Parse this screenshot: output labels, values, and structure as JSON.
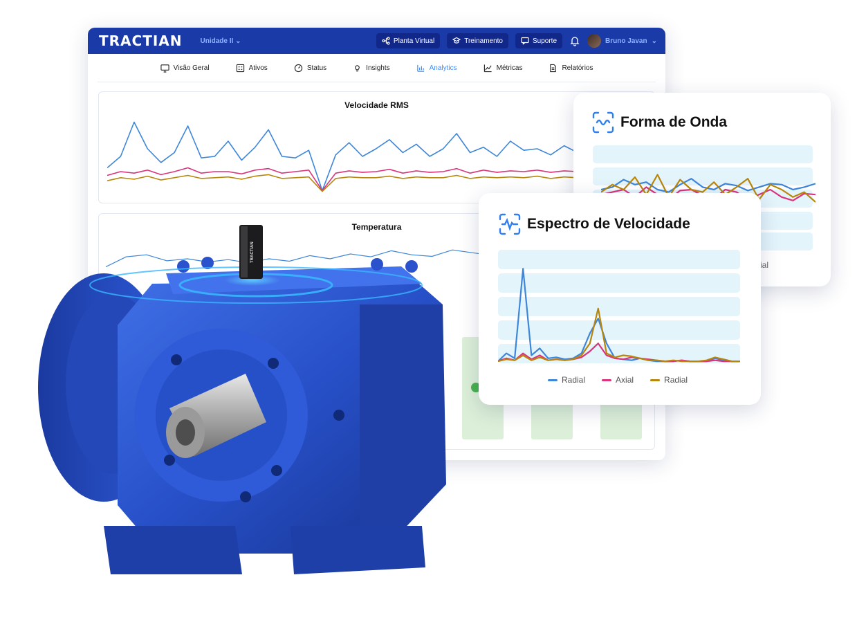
{
  "header": {
    "logo": "TRACTIAN",
    "unit": "Unidade II",
    "buttons": [
      {
        "label": "Planta Virtual",
        "icon": "network-icon"
      },
      {
        "label": "Treinamento",
        "icon": "training-icon"
      },
      {
        "label": "Suporte",
        "icon": "chat-icon"
      }
    ],
    "user": "Bruno Javan"
  },
  "tabs": [
    {
      "label": "Visão Geral",
      "icon": "monitor-icon"
    },
    {
      "label": "Ativos",
      "icon": "assets-icon"
    },
    {
      "label": "Status",
      "icon": "gauge-icon"
    },
    {
      "label": "Insights",
      "icon": "lightbulb-icon"
    },
    {
      "label": "Analytics",
      "icon": "bar-chart-icon",
      "active": true
    },
    {
      "label": "Métricas",
      "icon": "line-chart-icon"
    },
    {
      "label": "Relatórios",
      "icon": "document-icon"
    }
  ],
  "panels": {
    "rms_title": "Velocidade RMS",
    "temp_title": "Temperatura"
  },
  "cards": {
    "wave": {
      "title": "Forma de Onda",
      "legend_fragment": "ial"
    },
    "spectrum": {
      "title": "Espectro de Velocidade"
    }
  },
  "colors": {
    "brand": "#1a3aa8",
    "radial": "#3d86d9",
    "axial": "#d9347c",
    "radial2": "#b8860b",
    "accent": "#3d8bfd"
  },
  "chart_data": [
    {
      "type": "line",
      "title": "Velocidade RMS",
      "series": [
        {
          "values": [
            0.35,
            0.5,
            0.95,
            0.6,
            0.42,
            0.55,
            0.9,
            0.48,
            0.5,
            0.7,
            0.45,
            0.62,
            0.85,
            0.5,
            0.48,
            0.58,
            0.05,
            0.52,
            0.68,
            0.5,
            0.6,
            0.72,
            0.55,
            0.66,
            0.5,
            0.6,
            0.8,
            0.55,
            0.62,
            0.5,
            0.7,
            0.58,
            0.6,
            0.52,
            0.64,
            0.55
          ]
        },
        {
          "values": [
            0.25,
            0.3,
            0.28,
            0.32,
            0.26,
            0.3,
            0.35,
            0.28,
            0.3,
            0.3,
            0.27,
            0.32,
            0.34,
            0.28,
            0.3,
            0.32,
            0.05,
            0.28,
            0.31,
            0.29,
            0.3,
            0.33,
            0.28,
            0.31,
            0.29,
            0.3,
            0.34,
            0.28,
            0.32,
            0.29,
            0.31,
            0.3,
            0.32,
            0.29,
            0.31,
            0.3
          ]
        },
        {
          "values": [
            0.18,
            0.22,
            0.2,
            0.24,
            0.19,
            0.22,
            0.25,
            0.21,
            0.22,
            0.23,
            0.2,
            0.24,
            0.26,
            0.21,
            0.22,
            0.23,
            0.04,
            0.21,
            0.23,
            0.22,
            0.22,
            0.24,
            0.21,
            0.23,
            0.22,
            0.22,
            0.25,
            0.21,
            0.23,
            0.22,
            0.23,
            0.22,
            0.24,
            0.21,
            0.23,
            0.22
          ]
        }
      ]
    },
    {
      "type": "line",
      "title": "Temperatura",
      "series": [
        {
          "values": [
            0.3,
            0.55,
            0.6,
            0.45,
            0.5,
            0.42,
            0.48,
            0.4,
            0.5,
            0.44,
            0.58,
            0.5,
            0.62,
            0.55,
            0.7,
            0.6,
            0.56,
            0.72,
            0.65,
            0.58
          ]
        }
      ]
    },
    {
      "type": "line",
      "title": "Forma de Onda",
      "series": [
        {
          "name": "Radial",
          "values": [
            0.5,
            0.55,
            0.7,
            0.6,
            0.65,
            0.5,
            0.45,
            0.6,
            0.72,
            0.55,
            0.5,
            0.62,
            0.58,
            0.48,
            0.55,
            0.62,
            0.6,
            0.5,
            0.55,
            0.62
          ]
        },
        {
          "name": "Axial",
          "values": [
            0.4,
            0.45,
            0.5,
            0.35,
            0.55,
            0.4,
            0.3,
            0.48,
            0.5,
            0.38,
            0.32,
            0.5,
            0.45,
            0.3,
            0.4,
            0.5,
            0.35,
            0.28,
            0.42,
            0.4
          ]
        },
        {
          "name": "Radial",
          "values": [
            0.45,
            0.6,
            0.5,
            0.75,
            0.4,
            0.8,
            0.35,
            0.7,
            0.5,
            0.45,
            0.65,
            0.4,
            0.55,
            0.72,
            0.3,
            0.6,
            0.5,
            0.35,
            0.45,
            0.25
          ]
        }
      ]
    },
    {
      "type": "line",
      "title": "Espectro de Velocidade",
      "series": [
        {
          "name": "Radial",
          "values": [
            0.02,
            0.1,
            0.05,
            0.95,
            0.08,
            0.15,
            0.05,
            0.06,
            0.04,
            0.05,
            0.1,
            0.3,
            0.45,
            0.2,
            0.05,
            0.04,
            0.03,
            0.05,
            0.03,
            0.02,
            0.02,
            0.02,
            0.03,
            0.02,
            0.02,
            0.02,
            0.05,
            0.03,
            0.02,
            0.02
          ]
        },
        {
          "name": "Axial",
          "values": [
            0.02,
            0.05,
            0.03,
            0.1,
            0.04,
            0.08,
            0.03,
            0.04,
            0.03,
            0.04,
            0.06,
            0.12,
            0.2,
            0.08,
            0.05,
            0.04,
            0.06,
            0.05,
            0.04,
            0.03,
            0.02,
            0.02,
            0.03,
            0.02,
            0.02,
            0.02,
            0.03,
            0.02,
            0.02,
            0.02
          ]
        },
        {
          "name": "Radial",
          "values": [
            0.02,
            0.04,
            0.03,
            0.08,
            0.03,
            0.06,
            0.03,
            0.04,
            0.03,
            0.04,
            0.08,
            0.2,
            0.55,
            0.1,
            0.06,
            0.08,
            0.07,
            0.05,
            0.03,
            0.03,
            0.02,
            0.03,
            0.02,
            0.02,
            0.02,
            0.03,
            0.06,
            0.04,
            0.02,
            0.02
          ]
        }
      ]
    }
  ]
}
